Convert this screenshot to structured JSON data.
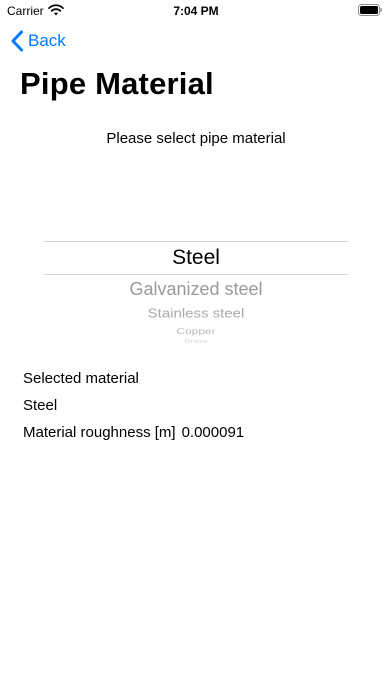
{
  "status_bar": {
    "carrier": "Carrier",
    "time": "7:04 PM"
  },
  "nav": {
    "back_label": "Back",
    "accent_color": "#007aff"
  },
  "page": {
    "title": "Pipe Material",
    "prompt": "Please select pipe material"
  },
  "picker": {
    "selected": "Steel",
    "options": [
      "Steel",
      "Galvanized steel",
      "Stainless steel",
      "Copper",
      "Brass"
    ]
  },
  "info": {
    "selected_material_label": "Selected material",
    "selected_material_value": "Steel",
    "roughness_label": "Material roughness [m]",
    "roughness_value": "0.000091"
  }
}
